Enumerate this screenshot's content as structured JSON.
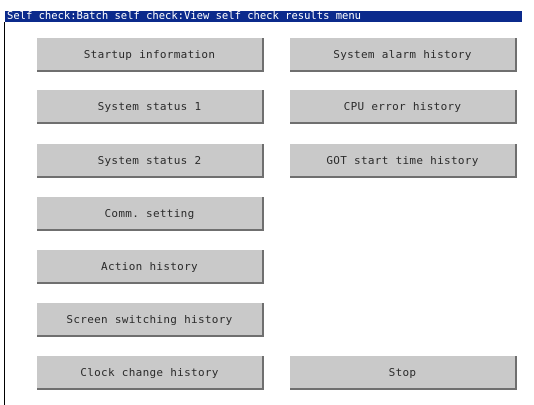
{
  "title": "Self check:Batch self check:View self check results menu",
  "left_buttons": [
    {
      "label": "Startup information"
    },
    {
      "label": "System status 1"
    },
    {
      "label": "System status 2"
    },
    {
      "label": "Comm. setting"
    },
    {
      "label": "Action history"
    },
    {
      "label": "Screen switching history"
    },
    {
      "label": "Clock change history"
    }
  ],
  "right_buttons": [
    {
      "label": "System alarm history"
    },
    {
      "label": "CPU error history"
    },
    {
      "label": "GOT start time history"
    }
  ],
  "stop_button": {
    "label": "Stop"
  }
}
